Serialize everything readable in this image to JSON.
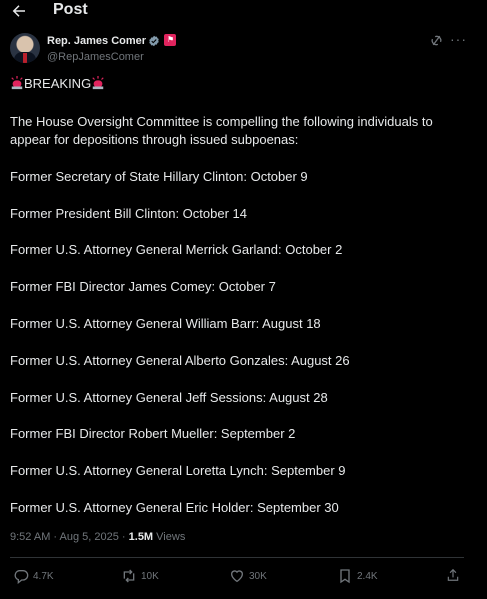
{
  "header": {
    "title": "Post"
  },
  "author": {
    "name": "Rep. James Comer",
    "handle": "@RepJamesComer"
  },
  "post": {
    "breaking": "BREAKING",
    "intro_line1": "The House Oversight Committee is compelling the following individuals to",
    "intro_line2": "appear for depositions through issued subpoenas:",
    "items": [
      "Former Secretary of State Hillary Clinton: October 9",
      "Former President Bill Clinton: October 14",
      "Former U.S. Attorney General Merrick Garland: October 2",
      "Former FBI Director James Comey: October 7",
      "Former U.S. Attorney General William Barr: August 18",
      "Former U.S. Attorney General Alberto Gonzales: August 26",
      "Former U.S. Attorney General Jeff Sessions: August 28",
      "Former FBI Director Robert Mueller: September 2",
      "Former U.S. Attorney General Loretta Lynch: September 9",
      "Former U.S. Attorney General Eric Holder: September 30"
    ]
  },
  "meta": {
    "timestamp": "9:52 AM · Aug 5, 2025 ·",
    "views_count": "1.5M",
    "views_label": "Views"
  },
  "actions": {
    "replies": "4.7K",
    "reposts": "10K",
    "likes": "30K",
    "bookmarks": "2.4K"
  },
  "icons": [
    "back-arrow-icon",
    "verified-badge-icon",
    "affiliation-flag-icon",
    "grok-icon",
    "more-icon",
    "siren-icon",
    "reply-icon",
    "repost-icon",
    "like-icon",
    "bookmark-icon",
    "share-icon"
  ],
  "colors": {
    "background": "#000000",
    "text": "#e7e9ea",
    "muted": "#71767b",
    "verified": "#829aab",
    "affiliation": "#e0245e",
    "siren": "#e0245e"
  }
}
